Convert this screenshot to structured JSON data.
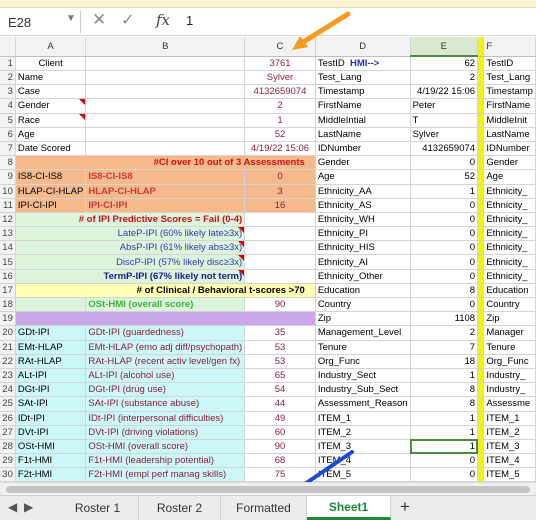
{
  "formula_bar": {
    "cell_ref": "E28",
    "fx": "fx",
    "value": "1",
    "cancel_glyph": "✕",
    "confirm_glyph": "✓",
    "dropdown_glyph": "▼"
  },
  "columns": [
    "",
    "A",
    "B",
    "C",
    "D",
    "E",
    "F"
  ],
  "rows": [
    {
      "n": "1",
      "a": "Client",
      "b": "",
      "c": "3761",
      "d": "TestID",
      "d2": "HMI-->",
      "e": "62",
      "f": "TestID"
    },
    {
      "n": "2",
      "a": "Name",
      "b": "",
      "c": "Sylver",
      "d": "Test_Lang",
      "e": "2",
      "f": "Test_Lang"
    },
    {
      "n": "3",
      "a": "Case",
      "b": "",
      "c": "4132659074",
      "d": "Timestamp",
      "e": "4/19/22 15:06",
      "f": "Timestamp"
    },
    {
      "n": "4",
      "a": "Gender",
      "b": "",
      "c": "2",
      "d": "FirstName",
      "e": "Peter",
      "f": "FirstName"
    },
    {
      "n": "5",
      "a": "Race",
      "b": "",
      "c": "1",
      "d": "MiddleIntial",
      "e": "T",
      "f": "MiddleInit"
    },
    {
      "n": "6",
      "a": "Age",
      "b": "",
      "c": "52",
      "d": "LastName",
      "e": "Sylver",
      "f": "LastName"
    },
    {
      "n": "7",
      "a": "Date Scored",
      "b": "",
      "c": "4/19/22 15:06",
      "d": "IDNumber",
      "e": "4132659074",
      "f": "IDNumber"
    },
    {
      "n": "8",
      "a": "",
      "b": "#CI over 10 out of 3 Assessments",
      "c": "",
      "d": "Gender",
      "e": "0",
      "f": "Gender"
    },
    {
      "n": "9",
      "a": "IS8-CI-IS8",
      "b": "IS8-CI-IS8",
      "c": "0",
      "d": "Age",
      "e": "52",
      "f": "Age"
    },
    {
      "n": "10",
      "a": "HLAP-CI-HLAP",
      "b": "HLAP-CI-HLAP",
      "c": "3",
      "d": "Ethnicity_AA",
      "e": "1",
      "f": "Ethnicity_"
    },
    {
      "n": "11",
      "a": "IPI-CI-IPI",
      "b": "IPI-CI-IPI",
      "c": "16",
      "d": "Ethnicity_AS",
      "e": "0",
      "f": "Ethnicity_"
    },
    {
      "n": "12",
      "a": "",
      "b": "# of IPI Predictive Scores = Fail (0-4)",
      "c": "",
      "d": "Ethnicity_WH",
      "e": "0",
      "f": "Ethnicity_"
    },
    {
      "n": "13",
      "a": "",
      "b": "LateP-IPI (60% likely late≥3x)",
      "c": "",
      "d": "Ethnicity_PI",
      "e": "0",
      "f": "Ethnicity_"
    },
    {
      "n": "14",
      "a": "",
      "b": "AbsP-IPI (61% likely abs≥3x)",
      "c": "",
      "d": "Ethnicity_HIS",
      "e": "0",
      "f": "Ethnicity_"
    },
    {
      "n": "15",
      "a": "",
      "b": "DiscP-IPI (57% likely disc≥3x)",
      "c": "",
      "d": "Ethnicity_AI",
      "e": "0",
      "f": "Ethnicity_"
    },
    {
      "n": "16",
      "a": "",
      "b": "TermP-IPI (67% likely not term)",
      "c": "",
      "d": "Ethnicity_Other",
      "e": "0",
      "f": "Ethnicity_"
    },
    {
      "n": "17",
      "a": "",
      "b": "# of Clinical / Behavioral t-scores >70",
      "c": "",
      "d": "Education",
      "e": "8",
      "f": "Education"
    },
    {
      "n": "18",
      "a": "",
      "b": "OSt-HMI (overall score)",
      "c": "90",
      "d": "Country",
      "e": "0",
      "f": "Country"
    },
    {
      "n": "19",
      "a": "",
      "b": "",
      "c": "",
      "d": "Zip",
      "e": "1108",
      "f": "Zip"
    },
    {
      "n": "20",
      "a": "GDt-IPI",
      "b": "GDt-IPI (guardedness)",
      "c": "35",
      "d": "Management_Level",
      "e": "2",
      "f": "Manager"
    },
    {
      "n": "21",
      "a": "EMt-HLAP",
      "b": "EMt-HLAP (emo adj diff/psychopath)",
      "c": "53",
      "d": "Tenure",
      "e": "7",
      "f": "Tenure"
    },
    {
      "n": "22",
      "a": "RAt-HLAP",
      "b": "RAt-HLAP (recent activ level/gen fx)",
      "c": "53",
      "d": "Org_Func",
      "e": "18",
      "f": "Org_Func"
    },
    {
      "n": "23",
      "a": "ALt-IPI",
      "b": "ALt-IPI (alcohol use)",
      "c": "65",
      "d": "Industry_Sect",
      "e": "1",
      "f": "Industry_"
    },
    {
      "n": "24",
      "a": "DGt-IPI",
      "b": "DGt-IPI (drug use)",
      "c": "54",
      "d": "Industry_Sub_Sect",
      "e": "8",
      "f": "Industry_"
    },
    {
      "n": "25",
      "a": "SAt-IPI",
      "b": "SAt-IPI (substance abuse)",
      "c": "44",
      "d": "Assessment_Reason",
      "e": "8",
      "f": "Assessme"
    },
    {
      "n": "26",
      "a": "IDt-IPI",
      "b": "IDt-IPI (interpersonal difficulties)",
      "c": "49",
      "d": "ITEM_1",
      "e": "1",
      "f": "ITEM_1"
    },
    {
      "n": "27",
      "a": "DVt-IPI",
      "b": "DVt-IPI (driving violations)",
      "c": "60",
      "d": "ITEM_2",
      "e": "1",
      "f": "ITEM_2"
    },
    {
      "n": "28",
      "a": "OSt-HMI",
      "b": "OSt-HMI (overall score)",
      "c": "90",
      "d": "ITEM_3",
      "e": "1",
      "f": "ITEM_3"
    },
    {
      "n": "29",
      "a": "F1t-HMI",
      "b": "F1t-HMI (leadership potential)",
      "c": "68",
      "d": "ITEM_4",
      "e": "0",
      "f": "ITEM_4"
    },
    {
      "n": "30",
      "a": "F2t-HMI",
      "b": "F2t-HMI (empl perf manag skills)",
      "c": "75",
      "d": "ITEM_5",
      "e": "0",
      "f": "ITEM_5"
    }
  ],
  "tabs": [
    "Roster 1",
    "Roster 2",
    "Formatted",
    "Sheet1"
  ],
  "active_tab": "Sheet1",
  "tab_nav": {
    "prev": "◀",
    "next": "▶",
    "add": "+"
  },
  "colors": {
    "orange_fill": "#f6b98c",
    "green_fill": "#dcf3dc",
    "purple_fill": "#c9a7e8",
    "cyan_fill": "#ccf7f7",
    "lightyellow_fill": "#ffffb3",
    "orange_arrow": "#f79a1e",
    "blue_arrow": "#1a4be0",
    "active_tab": "#1d8a3a"
  }
}
